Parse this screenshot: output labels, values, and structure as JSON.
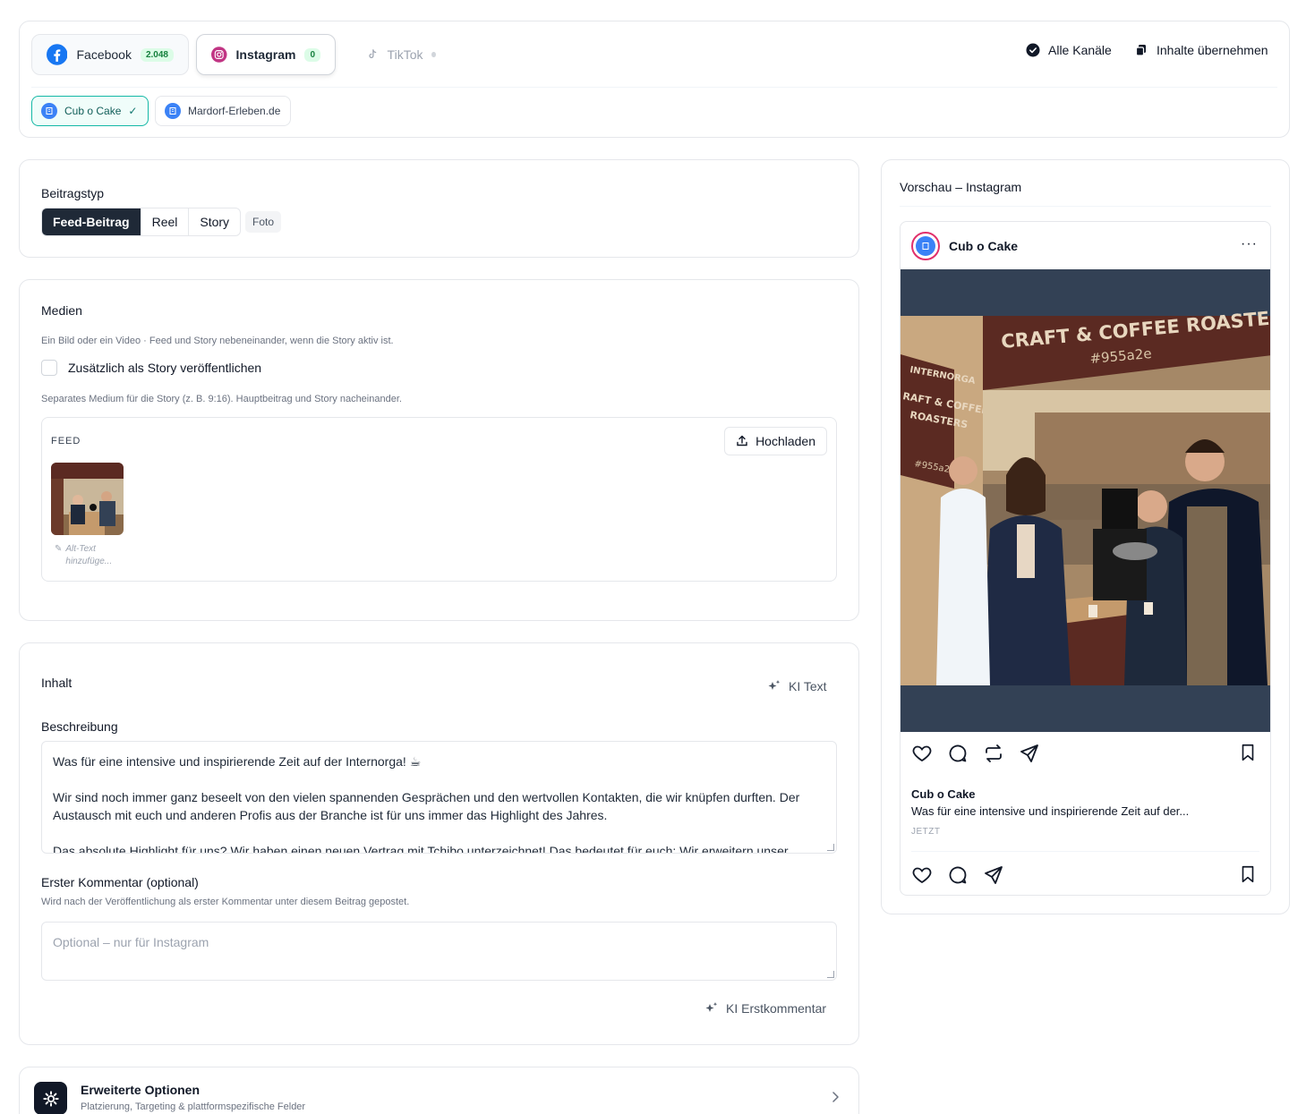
{
  "channels": {
    "facebook": {
      "label": "Facebook",
      "count": "2.048"
    },
    "instagram": {
      "label": "Instagram",
      "count": "0"
    },
    "tiktok": {
      "label": "TikTok"
    },
    "all_channels": "Alle Kanäle",
    "copy_content": "Inhalte übernehmen",
    "accounts": [
      {
        "label": "Cub o Cake",
        "selected": true
      },
      {
        "label": "Mardorf-Erleben.de",
        "selected": false
      }
    ]
  },
  "post_type": {
    "title": "Beitragstyp",
    "options": [
      "Feed-Beitrag",
      "Reel",
      "Story"
    ],
    "selected": "Feed-Beitrag",
    "media_chip": "Foto"
  },
  "media": {
    "title": "Medien",
    "hint": "Ein Bild oder ein Video · Feed und Story nebeneinander, wenn die Story aktiv ist.",
    "story_checkbox": "Zusätzlich als Story veröffentlichen",
    "story_hint": "Separates Medium für die Story (z. B. 9:16). Hauptbeitrag und Story nacheinander.",
    "feed_label": "FEED",
    "upload_button": "Hochladen",
    "alt_text": "Alt-Text hinzufüge..."
  },
  "content": {
    "title": "Inhalt",
    "ki_text": "KI Text",
    "description_label": "Beschreibung",
    "description_lines": [
      "Was für eine intensive und inspirierende Zeit auf der Internorga! ☕",
      "",
      "Wir sind noch immer ganz beseelt von den vielen spannenden Gesprächen und den wertvollen Kontakten, die wir knüpfen durften. Der Austausch mit euch und anderen Profis aus der Branche ist für uns immer das Highlight des Jahres.",
      "",
      "Das absolute Highlight für uns? Wir haben einen neuen Vertrag mit Tchibo unterzeichnet! Das bedeutet für euch: Wir erweitern unser"
    ],
    "first_comment_label": "Erster Kommentar (optional)",
    "first_comment_hint": "Wird nach der Veröffentlichung als erster Kommentar unter diesem Beitrag gepostet.",
    "first_comment_placeholder": "Optional – nur für Instagram",
    "ki_comment": "KI Erstkommentar"
  },
  "advanced": {
    "title": "Erweiterte Optionen",
    "subtitle": "Platzierung, Targeting & plattformspezifische Felder"
  },
  "preview": {
    "title": "Vorschau – Instagram",
    "account": "Cub o Cake",
    "more": "···",
    "caption_user": "Cub o Cake",
    "caption_text": "Was für eine intensive und inspirierende Zeit auf der...",
    "time": "JETZT",
    "image_sign_1": "CRAFT & COFFEE ROASTE",
    "image_sign_2": "#955a2e",
    "image_side_1": "INTERNORGA",
    "image_side_2": "RAFT & COFFEE",
    "image_side_3": "ROASTERS",
    "image_side_4": "#955a2e"
  },
  "colors": {
    "accent_teal": "#14b8a6",
    "facebook_blue": "#1877f2",
    "instagram_pink": "#e1306c",
    "image_background": "#334155"
  }
}
